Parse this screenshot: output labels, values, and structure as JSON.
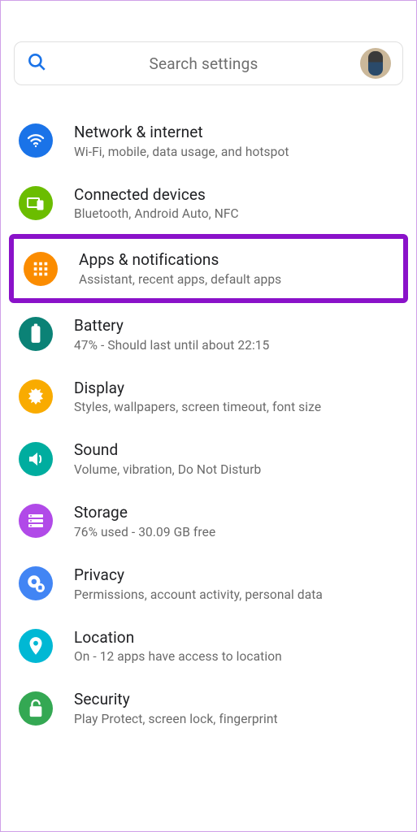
{
  "search": {
    "placeholder": "Search settings"
  },
  "items": [
    {
      "title": "Network & internet",
      "sub": "Wi-Fi, mobile, data usage, and hotspot"
    },
    {
      "title": "Connected devices",
      "sub": "Bluetooth, Android Auto, NFC"
    },
    {
      "title": "Apps & notifications",
      "sub": "Assistant, recent apps, default apps"
    },
    {
      "title": "Battery",
      "sub": "47% - Should last until about 22:15"
    },
    {
      "title": "Display",
      "sub": "Styles, wallpapers, screen timeout, font size"
    },
    {
      "title": "Sound",
      "sub": "Volume, vibration, Do Not Disturb"
    },
    {
      "title": "Storage",
      "sub": "76% used - 30.09 GB free"
    },
    {
      "title": "Privacy",
      "sub": "Permissions, account activity, personal data"
    },
    {
      "title": "Location",
      "sub": "On - 12 apps have access to location"
    },
    {
      "title": "Security",
      "sub": "Play Protect, screen lock, fingerprint"
    }
  ]
}
